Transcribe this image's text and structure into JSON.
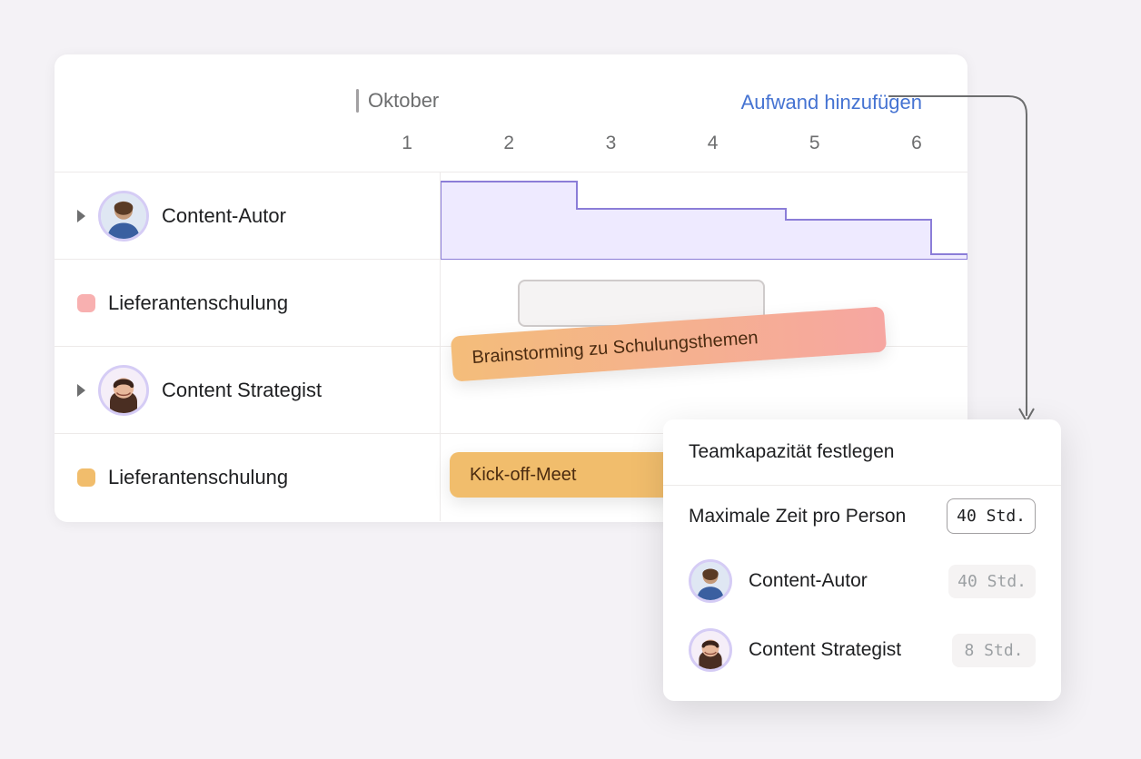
{
  "header": {
    "month": "Oktober",
    "days": [
      "1",
      "2",
      "3",
      "4",
      "5",
      "6"
    ],
    "add_effort_label": "Aufwand hinzufügen"
  },
  "rows": [
    {
      "kind": "person",
      "label": "Content-Autor",
      "avatar": "avatar-1"
    },
    {
      "kind": "project",
      "label": "Lieferantenschulung",
      "swatch": "pink"
    },
    {
      "kind": "person",
      "label": "Content Strategist",
      "avatar": "avatar-2"
    },
    {
      "kind": "project",
      "label": "Lieferantenschulung",
      "swatch": "amber"
    }
  ],
  "tasks": {
    "brainstorm": "Brainstorming zu Schulungsthemen",
    "kickoff": "Kick-off-Meet"
  },
  "popup": {
    "title": "Teamkapazität festlegen",
    "max_label": "Maximale Zeit pro Person",
    "max_value": "40 Std.",
    "members": [
      {
        "avatar": "avatar-1",
        "name": "Content-Autor",
        "hours": "40 Std."
      },
      {
        "avatar": "avatar-2",
        "name": "Content Strategist",
        "hours": "8 Std."
      }
    ]
  },
  "colors": {
    "accent": "#4573d2",
    "lavender": "#8b7dd8"
  }
}
